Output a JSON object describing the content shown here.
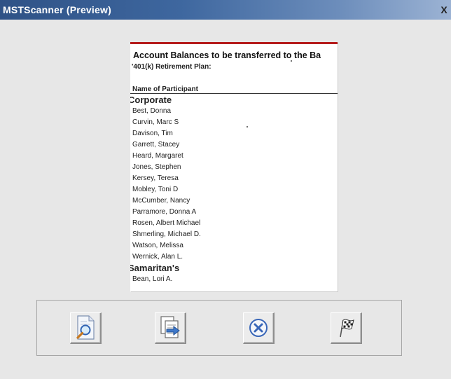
{
  "window": {
    "title": "MSTScanner (Preview)",
    "close_label": "X"
  },
  "document": {
    "title": "Account Balances to be transferred to the Ba",
    "subtitle": "'401(k) Retirement Plan:",
    "column_header": "Name of Participant",
    "rows": [
      {
        "text": "Corporate",
        "group": true
      },
      {
        "text": "Best, Donna",
        "group": false
      },
      {
        "text": "Curvin, Marc S",
        "group": false
      },
      {
        "text": "Davison, Tim",
        "group": false
      },
      {
        "text": "Garrett, Stacey",
        "group": false
      },
      {
        "text": "Heard, Margaret",
        "group": false
      },
      {
        "text": "Jones, Stephen",
        "group": false
      },
      {
        "text": "Kersey, Teresa",
        "group": false
      },
      {
        "text": "Mobley, Toni D",
        "group": false
      },
      {
        "text": "McCumber, Nancy",
        "group": false
      },
      {
        "text": "Parramore, Donna A",
        "group": false
      },
      {
        "text": "Rosen, Albert Michael",
        "group": false
      },
      {
        "text": "Shmerling, Michael D.",
        "group": false
      },
      {
        "text": "Watson, Melissa",
        "group": false
      },
      {
        "text": "Wernick, Alan L.",
        "group": false
      },
      {
        "text": "Samaritan's",
        "group": true
      },
      {
        "text": "Bean, Lori A.",
        "group": false
      }
    ]
  },
  "toolbar": {
    "buttons": [
      {
        "icon": "zoom-document-icon"
      },
      {
        "icon": "export-document-icon"
      },
      {
        "icon": "cancel-icon"
      },
      {
        "icon": "checkered-flag-icon"
      }
    ]
  },
  "colors": {
    "titlebar_start": "#2f5286",
    "titlebar_end": "#9cb3d4",
    "window_bg": "#e7e7e7",
    "doc_accent": "#b51c1c",
    "cancel_blue": "#3a67b8"
  }
}
